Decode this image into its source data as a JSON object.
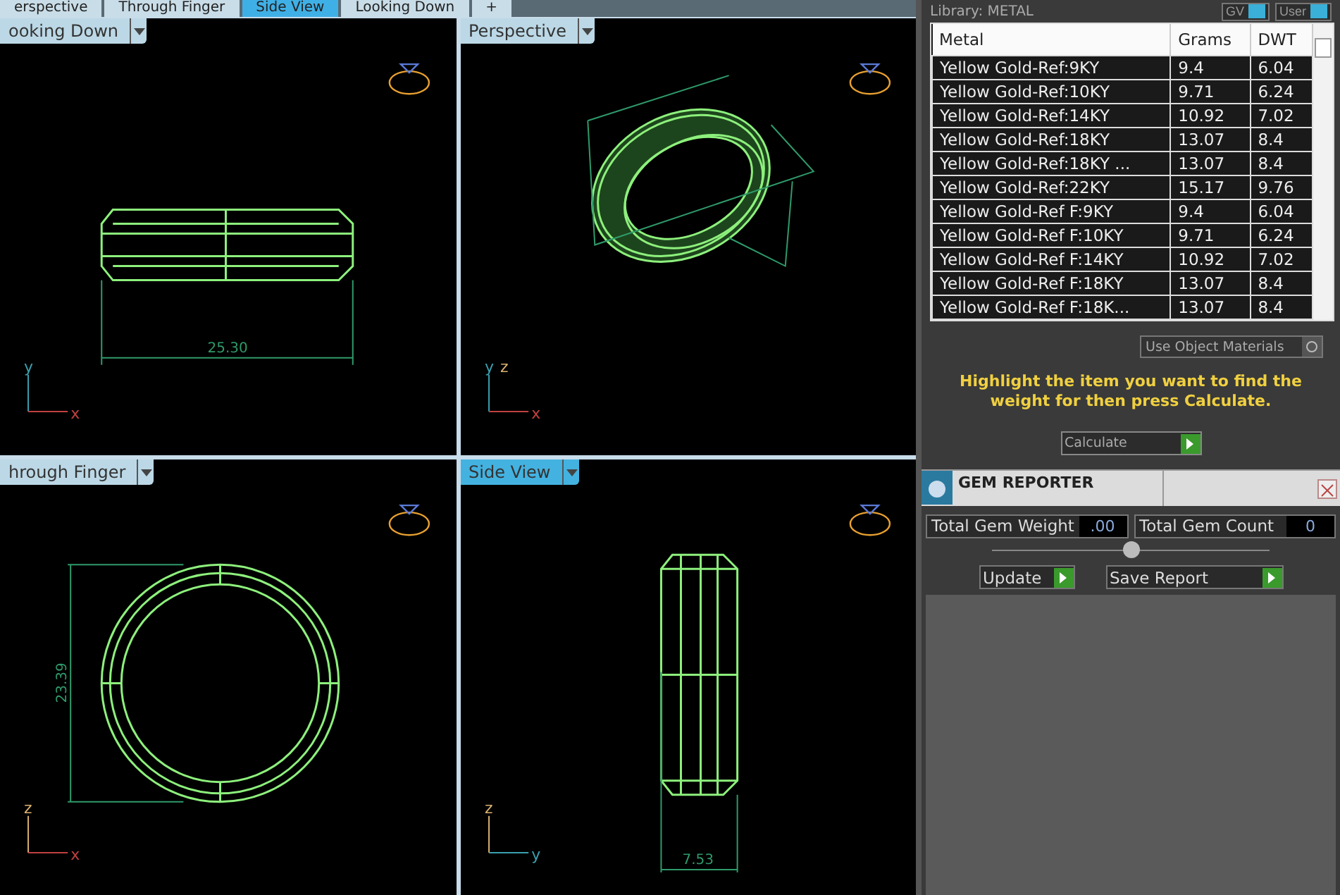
{
  "tabs": [
    {
      "label": "erspective",
      "selected": false
    },
    {
      "label": "Through Finger",
      "selected": false
    },
    {
      "label": "Side View",
      "selected": true
    },
    {
      "label": "Looking Down",
      "selected": false
    },
    {
      "label": "+",
      "selected": false
    }
  ],
  "viewports": [
    {
      "label": "ooking Down",
      "selected": false,
      "kind": "top",
      "dimension": "25.30",
      "axes": [
        {
          "label": "y",
          "color": "#3aa0b0"
        },
        {
          "label": "x",
          "color": "#c04040"
        }
      ]
    },
    {
      "label": "Perspective",
      "selected": false,
      "kind": "perspective",
      "axes": [
        {
          "label": "y",
          "color": "#3aa0b0"
        },
        {
          "label": "z",
          "color": "#d8b070"
        },
        {
          "label": "x",
          "color": "#c04040"
        }
      ]
    },
    {
      "label": "hrough Finger",
      "selected": false,
      "kind": "front",
      "dimension": "23.39",
      "axes": [
        {
          "label": "z",
          "color": "#d8b070"
        },
        {
          "label": "x",
          "color": "#c04040"
        }
      ]
    },
    {
      "label": "Side View",
      "selected": true,
      "kind": "side",
      "dimension": "7.53",
      "axes": [
        {
          "label": "z",
          "color": "#d8b070"
        },
        {
          "label": "y",
          "color": "#3aa0b0"
        }
      ]
    }
  ],
  "library": {
    "title": "Library: METAL",
    "buttons": [
      "GV",
      "User"
    ]
  },
  "metal_table": {
    "columns": [
      "Metal",
      "Grams",
      "DWT"
    ],
    "rows": [
      [
        "Yellow Gold-Ref:9KY",
        "9.4",
        "6.04"
      ],
      [
        "Yellow Gold-Ref:10KY",
        "9.71",
        "6.24"
      ],
      [
        "Yellow Gold-Ref:14KY",
        "10.92",
        "7.02"
      ],
      [
        "Yellow Gold-Ref:18KY",
        "13.07",
        "8.4"
      ],
      [
        "Yellow Gold-Ref:18KY ...",
        "13.07",
        "8.4"
      ],
      [
        "Yellow Gold-Ref:22KY",
        "15.17",
        "9.76"
      ],
      [
        "Yellow Gold-Ref F:9KY",
        "9.4",
        "6.04"
      ],
      [
        "Yellow Gold-Ref F:10KY",
        "9.71",
        "6.24"
      ],
      [
        "Yellow Gold-Ref F:14KY",
        "10.92",
        "7.02"
      ],
      [
        "Yellow Gold-Ref F:18KY",
        "13.07",
        "8.4"
      ],
      [
        "Yellow Gold-Ref F:18K...",
        "13.07",
        "8.4"
      ]
    ]
  },
  "use_object_materials": {
    "label": "Use Object Materials",
    "on": false
  },
  "message": "Highlight the item you want to find the weight for then press Calculate.",
  "calculate_button": "Calculate",
  "gem_reporter": {
    "title": "GEM REPORTER",
    "fields": [
      {
        "label": "Total Gem Weight",
        "value": ".00"
      },
      {
        "label": "Total Gem Count",
        "value": "0"
      }
    ],
    "buttons": [
      "Update",
      "Save Report"
    ]
  }
}
